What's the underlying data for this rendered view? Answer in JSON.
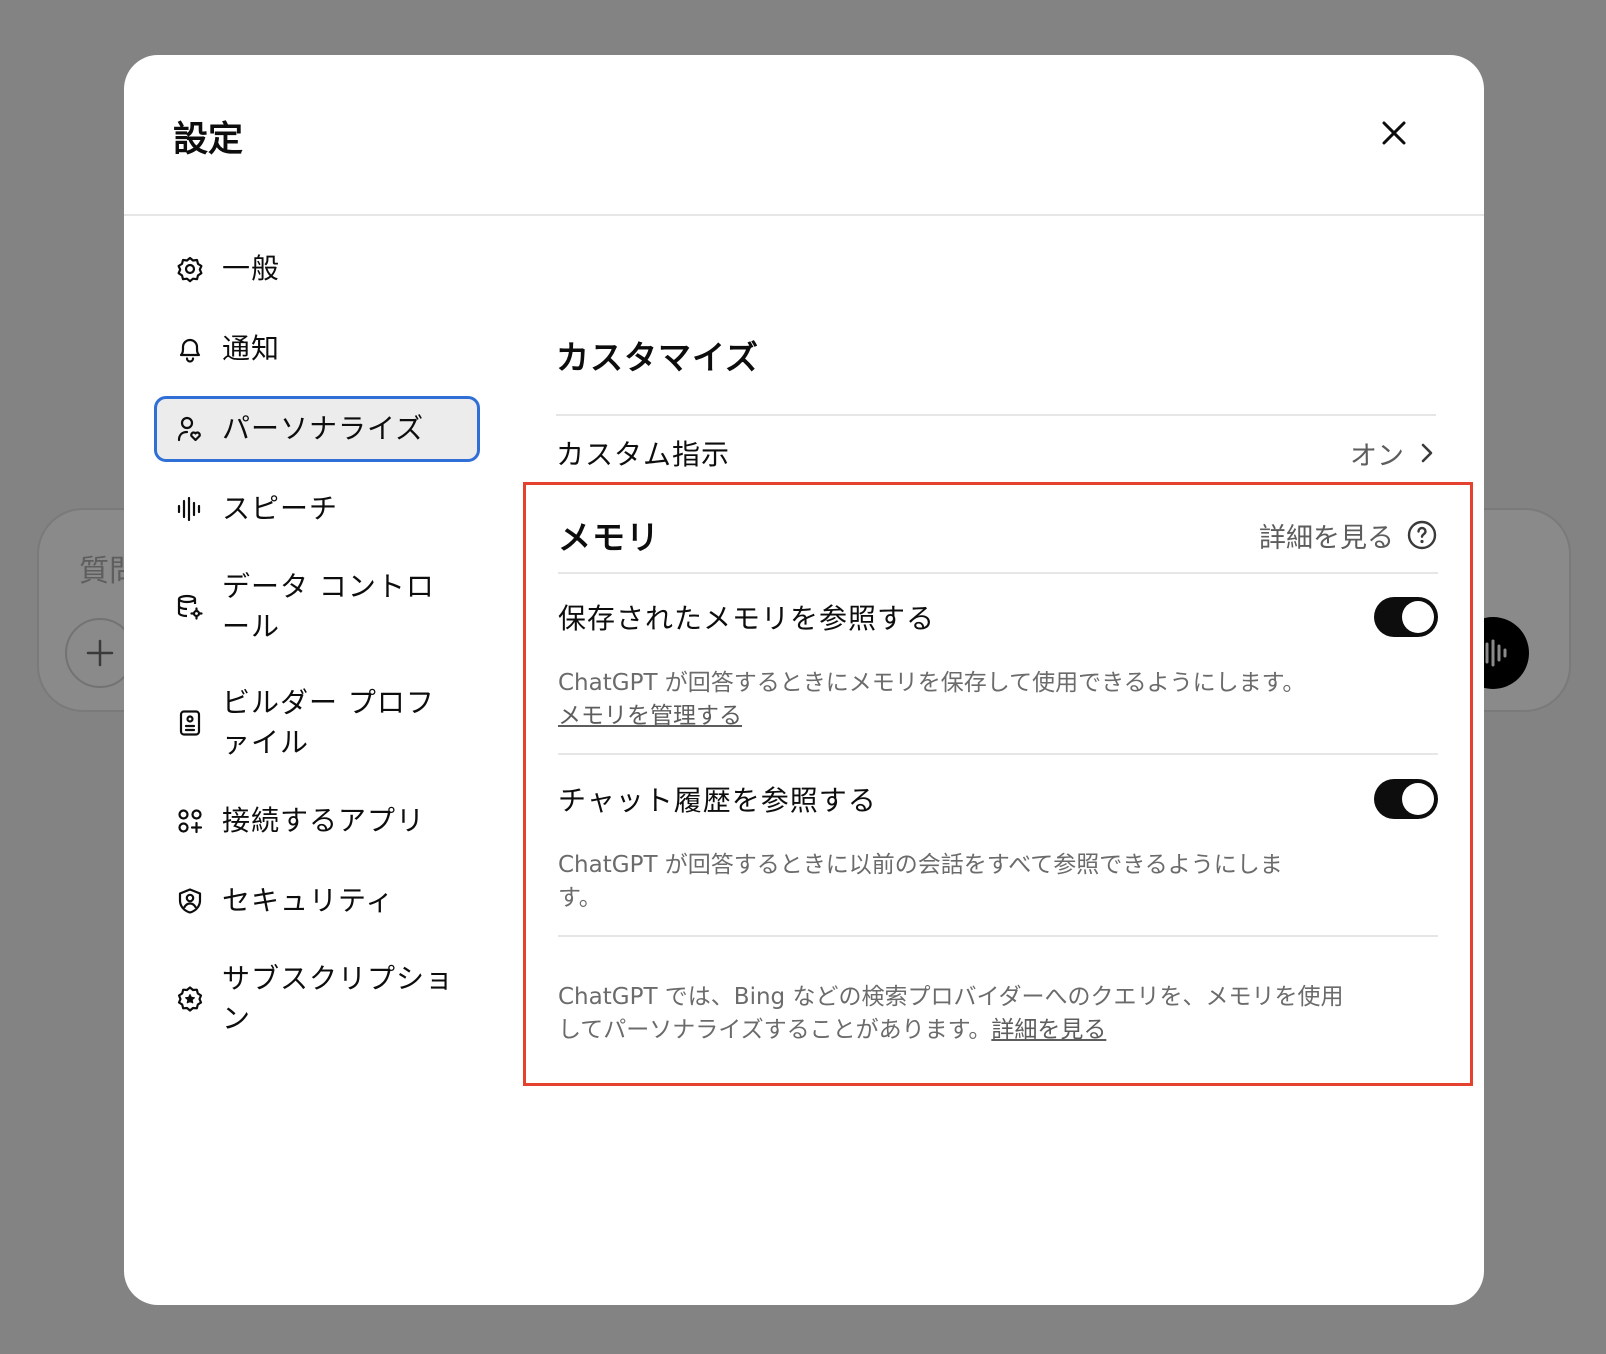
{
  "background": {
    "composer_placeholder": "質問"
  },
  "modal": {
    "title": "設定",
    "close_label": "閉じる"
  },
  "sidebar": {
    "items": [
      {
        "label": "一般",
        "icon": "gear-icon"
      },
      {
        "label": "通知",
        "icon": "bell-icon"
      },
      {
        "label": "パーソナライズ",
        "icon": "user-heart-icon",
        "active": true
      },
      {
        "label": "スピーチ",
        "icon": "waveform-icon"
      },
      {
        "label": "データ コントロール",
        "icon": "database-gear-icon"
      },
      {
        "label": "ビルダー プロファイル",
        "icon": "id-card-icon"
      },
      {
        "label": "接続するアプリ",
        "icon": "apps-grid-icon"
      },
      {
        "label": "セキュリティ",
        "icon": "shield-user-icon"
      },
      {
        "label": "サブスクリプション",
        "icon": "badge-star-icon"
      }
    ]
  },
  "content": {
    "customize_title": "カスタマイズ",
    "custom_instructions": {
      "label": "カスタム指示",
      "value": "オン"
    },
    "memory": {
      "title": "メモリ",
      "learn_more": "詳細を見る",
      "saved_memory": {
        "label": "保存されたメモリを参照する",
        "enabled": true,
        "description": "ChatGPT が回答するときにメモリを保存して使用できるようにします。",
        "link": "メモリを管理する"
      },
      "chat_history": {
        "label": "チャット履歴を参照する",
        "enabled": true,
        "description": "ChatGPT が回答するときに以前の会話をすべて参照できるようにします。"
      },
      "footnote": {
        "text": "ChatGPT では、Bing などの検索プロバイダーへのクエリを、メモリを使用してパーソナライズすることがあります。",
        "link": "詳細を見る"
      }
    }
  },
  "colors": {
    "highlight_border": "#e4412f",
    "active_border": "#2f6fd6",
    "toggle_on": "#0d0d0d"
  }
}
